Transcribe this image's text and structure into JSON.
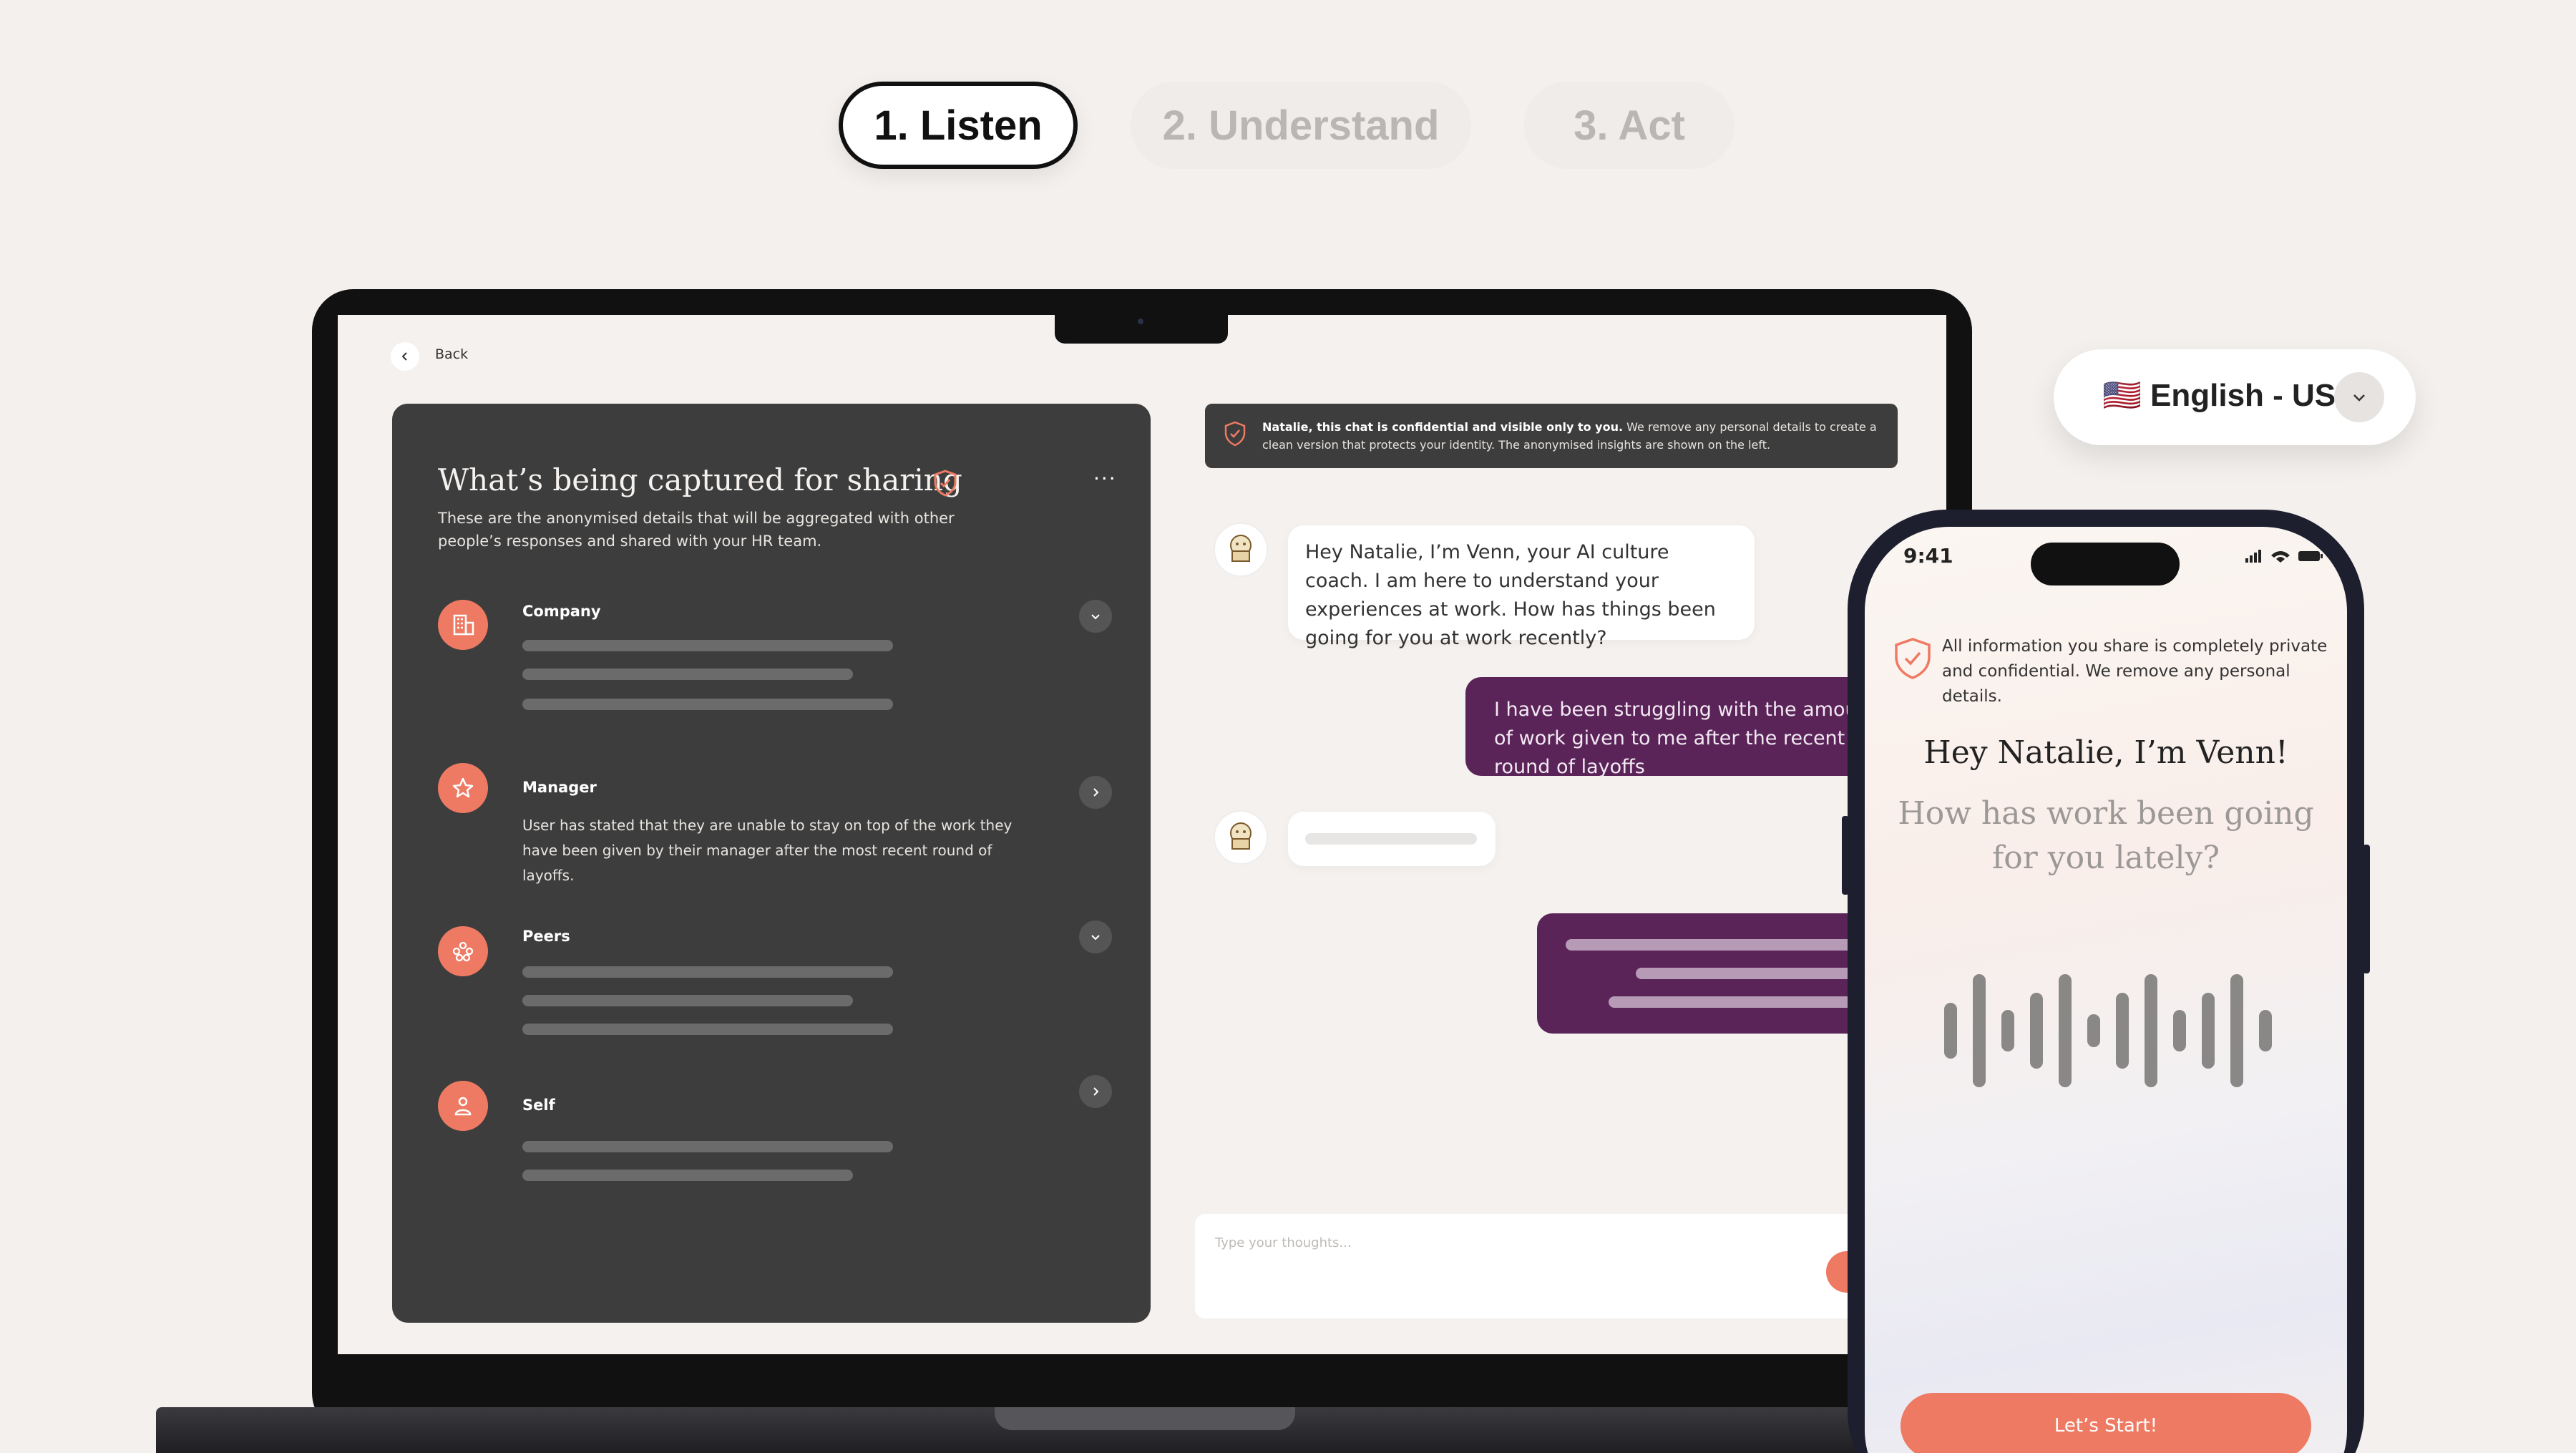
{
  "steps": [
    {
      "label": "1. Listen"
    },
    {
      "label": "2. Understand"
    },
    {
      "label": "3. Act"
    }
  ],
  "laptop": {
    "back_label": "Back",
    "panel": {
      "title": "What’s being captured for sharing",
      "subtitle": "These are the anonymised details that will be aggregated with other people’s responses and shared with your HR team.",
      "more_label": "...",
      "categories": [
        {
          "label": "Company",
          "icon": "building-icon",
          "state": "collapsed"
        },
        {
          "label": "Manager",
          "icon": "star-icon",
          "state": "expanded",
          "text": "User has stated that they are unable to stay on top of the work they have been given by their manager after the most recent round of layoffs."
        },
        {
          "label": "Peers",
          "icon": "group-icon",
          "state": "collapsed"
        },
        {
          "label": "Self",
          "icon": "person-icon",
          "state": "expanded"
        }
      ]
    },
    "chat": {
      "banner_bold": "Natalie, this chat is confidential and visible only to you.",
      "banner_rest": "We remove any personal details to create a clean version that protects your identity. The anonymised insights are shown on the left.",
      "messages": [
        {
          "from": "ai",
          "text": "Hey Natalie, I’m Venn, your AI culture coach. I am here to understand your experiences at work. How has things been going for you at work recently?"
        },
        {
          "from": "user",
          "text": "I have been struggling with the amount of work given to me after the recent round of layoffs"
        }
      ],
      "input_placeholder": "Type your thoughts..."
    }
  },
  "language": {
    "flag": "🇺🇸",
    "label": "English - US"
  },
  "phone": {
    "time": "9:41",
    "privacy_note": "All information you share is completely private and confidential.  We remove any personal details.",
    "greeting": "Hey Natalie, I’m Venn!",
    "question": "How has work been going for you lately?",
    "cta_label": "Let’s Start!"
  },
  "colors": {
    "background": "#f3f0ed",
    "panel": "#3d3d3d",
    "accent": "#ee7a63",
    "user_bubble": "#5a2458"
  }
}
